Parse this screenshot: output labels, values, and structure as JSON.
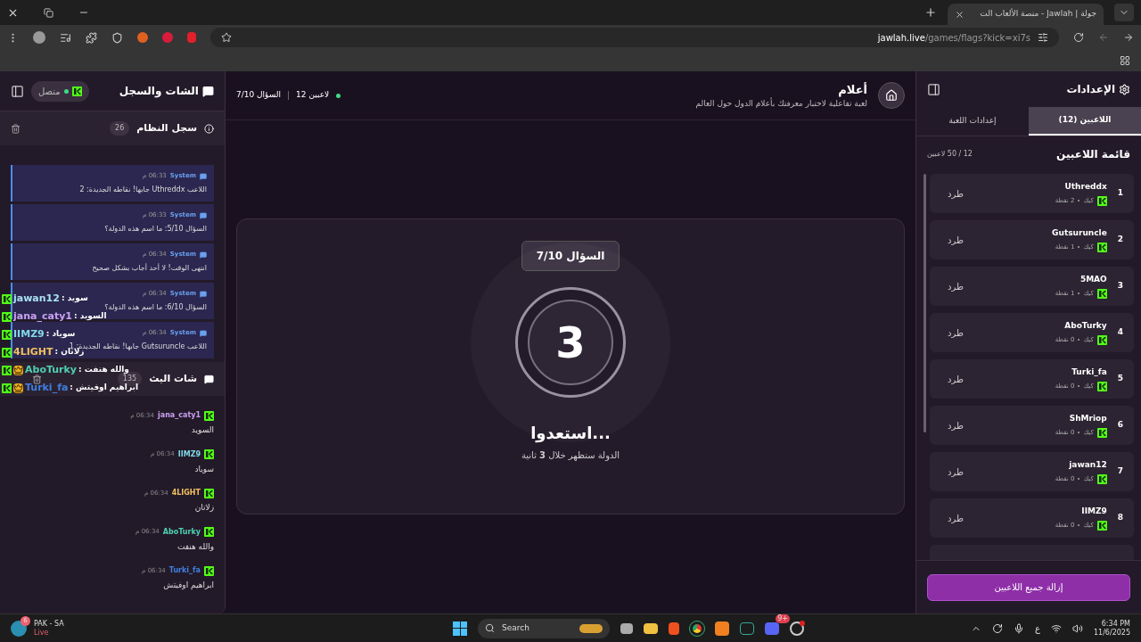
{
  "browser": {
    "tab_title": "جولة | Jawlah - منصة الألعاب الت",
    "url_host": "jawlah.live",
    "url_path": "/games/flags?kick=xi7s"
  },
  "left_panel": {
    "title": "الشات والسجل",
    "status": "متصل",
    "connected": true,
    "system_log": {
      "title": "سجل النظام",
      "count": "26",
      "messages": [
        {
          "sender": "System",
          "time": "06:33 م",
          "text": "اللاعب Uthreddx جابها! نقاطه الجديدة: 2"
        },
        {
          "sender": "System",
          "time": "06:33 م",
          "text": "السؤال 5/10: ما اسم هذه الدولة؟"
        },
        {
          "sender": "System",
          "time": "06:34 م",
          "text": "انتهى الوقت! لا أحد أجاب بشكل صحيح"
        },
        {
          "sender": "System",
          "time": "06:34 م",
          "text": "السؤال 6/10: ما اسم هذه الدولة؟"
        },
        {
          "sender": "System",
          "time": "06:34 م",
          "text": "اللاعب Gutsuruncle جابها! نقاطه الجديدة: 1"
        }
      ]
    },
    "stream_chat": {
      "title": "شات البث",
      "count": "135",
      "messages": [
        {
          "user": "jana_caty1",
          "color": "#c9a0f0",
          "time": "06:34 م",
          "text": "السويد"
        },
        {
          "user": "IIMZ9",
          "color": "#7fd8e8",
          "time": "06:34 م",
          "text": "سوياد"
        },
        {
          "user": "4LIGHT",
          "color": "#f0c060",
          "time": "06:34 م",
          "text": "زلاتان"
        },
        {
          "user": "AboTurky",
          "color": "#4fd0b0",
          "time": "06:34 م",
          "text": "والله هنفت"
        },
        {
          "user": "Turki_fa",
          "color": "#3f7fe0",
          "time": "06:34 م",
          "text": "ابراهيم اوفيتش"
        }
      ]
    }
  },
  "chat_overlay": [
    {
      "user": "jawan12",
      "color": "#a8e0f0",
      "text": "سويد :",
      "crown": false
    },
    {
      "user": "jana_caty1",
      "color": "#c9a0f0",
      "text": "السويد :",
      "crown": false
    },
    {
      "user": "IIMZ9",
      "color": "#7fd8e8",
      "text": "سوياد :",
      "crown": false
    },
    {
      "user": "4LIGHT",
      "color": "#f0c060",
      "text": "زلاتان :",
      "crown": false
    },
    {
      "user": "AboTurky",
      "color": "#4fd0b0",
      "text": "والله هنفت :",
      "crown": true
    },
    {
      "user": "Turki_fa",
      "color": "#3f7fe0",
      "text": "ابراهيم اوفيتش :",
      "crown": true
    }
  ],
  "game": {
    "title": "أعلام",
    "subtitle": "لعبة تفاعلية لاختبار معرفتك بأعلام الدول حول العالم",
    "players": "12 لاعبين",
    "question": "السؤال 7/10",
    "card": {
      "badge": "السؤال 7/10",
      "countdown": "3",
      "heading": "استعدوا...",
      "note": "الدولة ستظهر خلال **3** ثانية"
    }
  },
  "settings": {
    "title": "الإعدادات",
    "tabs": [
      {
        "label": "اللاعبين (12)",
        "selected": true
      },
      {
        "label": "إعدادات اللعبة",
        "selected": false
      }
    ],
    "list_title": "قائمة اللاعبين",
    "list_count": "12 / 50 لاعبين",
    "players": [
      {
        "rank": "1",
        "name": "Uthreddx",
        "platform": "كيك",
        "points": "2 نقطة",
        "action": "طرد"
      },
      {
        "rank": "2",
        "name": "Gutsuruncle",
        "platform": "كيك",
        "points": "1 نقطة",
        "action": "طرد"
      },
      {
        "rank": "3",
        "name": "5MAO",
        "platform": "كيك",
        "points": "1 نقطة",
        "action": "طرد"
      },
      {
        "rank": "4",
        "name": "AboTurky",
        "platform": "كيك",
        "points": "0 نقطة",
        "action": "طرد"
      },
      {
        "rank": "5",
        "name": "Turki_fa",
        "platform": "كيك",
        "points": "0 نقطة",
        "action": "طرد"
      },
      {
        "rank": "6",
        "name": "ShMriop",
        "platform": "كيك",
        "points": "0 نقطة",
        "action": "طرد"
      },
      {
        "rank": "7",
        "name": "jawan12",
        "platform": "كيك",
        "points": "0 نقطة",
        "action": "طرد"
      },
      {
        "rank": "8",
        "name": "IIMZ9",
        "platform": "كيك",
        "points": "0 نقطة",
        "action": "طرد"
      }
    ],
    "remove_all": "إزالة جميع اللاعبين"
  },
  "taskbar": {
    "stream_title": "PAK - SA",
    "stream_status": "Live",
    "stream_badge": "6",
    "search": "Search",
    "chat_badge": "9+",
    "language": "ع",
    "time": "6:34 PM",
    "date": "11/6/2025"
  }
}
